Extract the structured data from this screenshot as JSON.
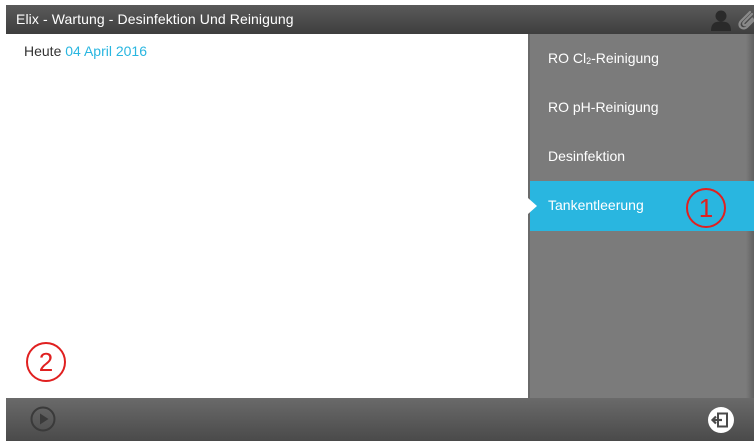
{
  "window": {
    "title": "Elix - Wartung - Desinfektion Und Reinigung"
  },
  "main": {
    "today_label": "Heute",
    "today_date": "04 April 2016"
  },
  "sidebar": {
    "items": [
      {
        "label_prefix": "RO Cl",
        "label_sub": "2",
        "label_suffix": "-Reinigung",
        "active": false
      },
      {
        "label": "RO pH-Reinigung",
        "active": false
      },
      {
        "label": "Desinfektion",
        "active": false
      },
      {
        "label": "Tankentleerung",
        "active": true
      }
    ]
  },
  "annotations": {
    "marker_1": "1",
    "marker_2": "2"
  },
  "icons": {
    "user": "user-icon",
    "attach": "paperclip-icon",
    "play": "play-icon",
    "exit": "exit-icon"
  },
  "colors": {
    "accent": "#29b6e0",
    "sidebar": "#7b7b7b",
    "bar": "#4a4a4a",
    "annotation": "#e02020"
  }
}
